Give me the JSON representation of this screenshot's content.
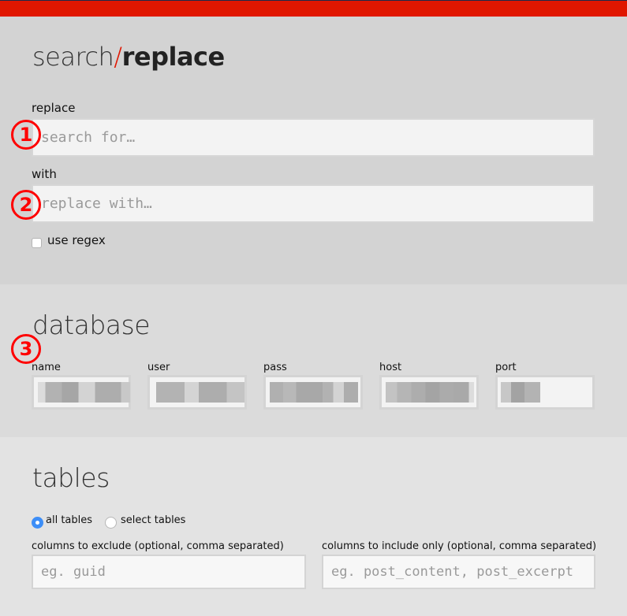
{
  "header": {
    "title_part1": "search",
    "title_slash": "/",
    "title_part2": "replace",
    "accent_color": "#e01600"
  },
  "search_section": {
    "replace_label": "replace",
    "search_placeholder": "search for…",
    "search_value": "",
    "with_label": "with",
    "replace_placeholder": "replace with…",
    "replace_value": "",
    "regex_label": "use regex",
    "regex_checked": false
  },
  "annotations": [
    "1",
    "2",
    "3"
  ],
  "database_section": {
    "title": "database",
    "fields": [
      {
        "label": "name",
        "value": "[redacted]"
      },
      {
        "label": "user",
        "value": "[redacted]"
      },
      {
        "label": "pass",
        "value": "[redacted]"
      },
      {
        "label": "host",
        "value": "[redacted]"
      },
      {
        "label": "port",
        "value": "[redacted]"
      }
    ]
  },
  "tables_section": {
    "title": "tables",
    "radio_options": [
      {
        "label": "all tables",
        "selected": true
      },
      {
        "label": "select tables",
        "selected": false
      }
    ],
    "exclude_label": "columns to exclude (optional, comma separated)",
    "exclude_placeholder": "eg. guid",
    "include_label": "columns to include only (optional, comma separated)",
    "include_placeholder": "eg. post_content, post_excerpt"
  }
}
